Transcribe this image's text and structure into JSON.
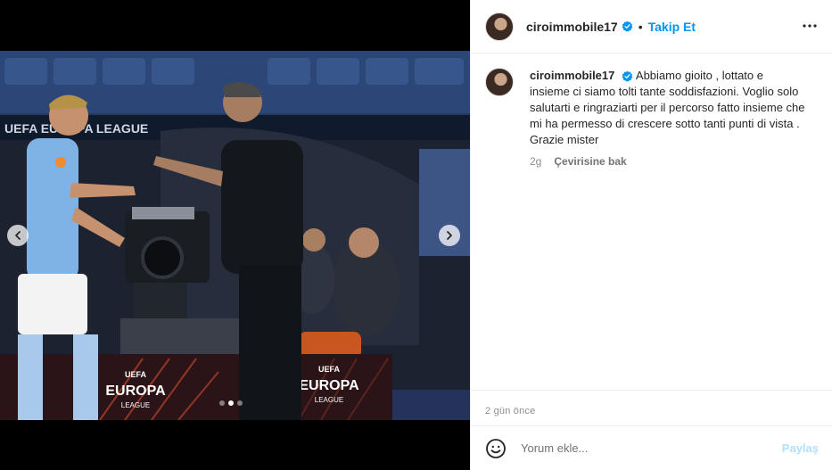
{
  "post": {
    "username": "ciroimmobile17",
    "follow_label": "Takip Et",
    "separator": "•",
    "caption_user": "ciroimmobile17",
    "caption": "Abbiamo gioito , lottato e insieme ci siamo tolti tante soddisfazioni. Voglio solo salutarti e ringraziarti per il percorso fatto insieme che mi ha permesso di crescere sotto tanti punti di vista . Grazie mister",
    "caption_age": "2g",
    "translate_label": "Çevirisine bak",
    "date": "2 gün önce",
    "comment_placeholder": "Yorum ekle...",
    "post_label": "Paylaş"
  },
  "photo": {
    "board_left_line1": "UEFA",
    "board_left_line2": "EUROPA",
    "board_left_line3": "LEAGUE",
    "board_right_line1": "UEFA",
    "board_right_line2": "EUROPA",
    "board_right_line3": "LEAGUE",
    "banner_text": "UEFA EUROPA LEAGUE"
  },
  "carousel": {
    "dots": 3,
    "active": 1
  },
  "colors": {
    "accent": "#0095f6",
    "verified": "#0095f6",
    "post_disabled": "#b2dffc"
  },
  "icons": [
    "verified-badge-icon",
    "more-options-icon",
    "chevron-left-icon",
    "chevron-right-icon",
    "emoji-icon"
  ]
}
